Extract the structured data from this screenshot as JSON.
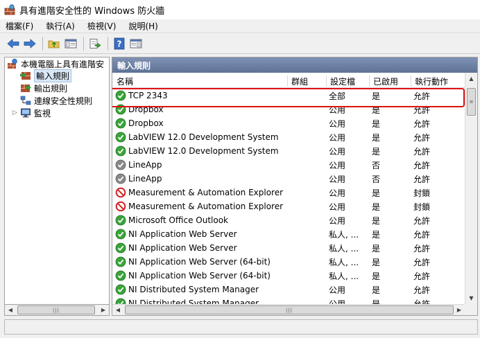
{
  "window": {
    "title": "具有進階安全性的 Windows 防火牆",
    "app_icon": "firewall-app-icon"
  },
  "menu": [
    {
      "label": "檔案(F)"
    },
    {
      "label": "執行(A)"
    },
    {
      "label": "檢視(V)"
    },
    {
      "label": "說明(H)"
    }
  ],
  "toolbar": {
    "buttons": [
      "back-arrow-icon",
      "forward-arrow-icon",
      "up-folder-icon",
      "show-hide-tree-icon",
      "export-list-icon",
      "help-icon",
      "show-hide-action-pane-icon"
    ]
  },
  "tree": {
    "root": "本機電腦上具有進階安",
    "items": [
      {
        "label": "輸入規則",
        "selected": true
      },
      {
        "label": "輸出規則",
        "selected": false
      },
      {
        "label": "連線安全性規則",
        "selected": false
      },
      {
        "label": "監視",
        "selected": false
      }
    ]
  },
  "rules_pane": {
    "title": "輸入規則",
    "columns": {
      "name": "名稱",
      "group": "群組",
      "profile": "設定檔",
      "enabled": "已啟用",
      "action": "執行動作"
    },
    "rows": [
      {
        "name": "TCP 2343",
        "profile": "全部",
        "enabled": "是",
        "action": "允許",
        "status": "allow-enabled"
      },
      {
        "name": "Dropbox",
        "profile": "公用",
        "enabled": "是",
        "action": "允許",
        "status": "allow-enabled"
      },
      {
        "name": "Dropbox",
        "profile": "公用",
        "enabled": "是",
        "action": "允許",
        "status": "allow-enabled"
      },
      {
        "name": "LabVIEW 12.0 Development System",
        "profile": "公用",
        "enabled": "是",
        "action": "允許",
        "status": "allow-enabled"
      },
      {
        "name": "LabVIEW 12.0 Development System",
        "profile": "公用",
        "enabled": "是",
        "action": "允許",
        "status": "allow-enabled"
      },
      {
        "name": "LineApp",
        "profile": "公用",
        "enabled": "否",
        "action": "允許",
        "status": "allow-disabled"
      },
      {
        "name": "LineApp",
        "profile": "公用",
        "enabled": "否",
        "action": "允許",
        "status": "allow-disabled"
      },
      {
        "name": "Measurement & Automation Explorer",
        "profile": "公用",
        "enabled": "是",
        "action": "封鎖",
        "status": "block"
      },
      {
        "name": "Measurement & Automation Explorer",
        "profile": "公用",
        "enabled": "是",
        "action": "封鎖",
        "status": "block"
      },
      {
        "name": "Microsoft Office Outlook",
        "profile": "公用",
        "enabled": "是",
        "action": "允許",
        "status": "allow-enabled"
      },
      {
        "name": "NI Application Web Server",
        "profile": "私人, ...",
        "enabled": "是",
        "action": "允許",
        "status": "allow-enabled"
      },
      {
        "name": "NI Application Web Server",
        "profile": "私人, ...",
        "enabled": "是",
        "action": "允許",
        "status": "allow-enabled"
      },
      {
        "name": "NI Application Web Server (64-bit)",
        "profile": "私人, ...",
        "enabled": "是",
        "action": "允許",
        "status": "allow-enabled"
      },
      {
        "name": "NI Application Web Server (64-bit)",
        "profile": "私人, ...",
        "enabled": "是",
        "action": "允許",
        "status": "allow-enabled"
      },
      {
        "name": "NI Distributed System Manager",
        "profile": "公用",
        "enabled": "是",
        "action": "允許",
        "status": "allow-enabled"
      },
      {
        "name": "NI Distributed System Manager",
        "profile": "公用",
        "enabled": "是",
        "action": "允許",
        "status": "allow-enabled"
      }
    ],
    "highlighted_row": 0
  },
  "colors": {
    "pane_header": "#6a7fa0",
    "allow": "#3aa53a",
    "disabled": "#8a8a8a",
    "block": "#d42020",
    "highlight_border": "#e01010"
  }
}
